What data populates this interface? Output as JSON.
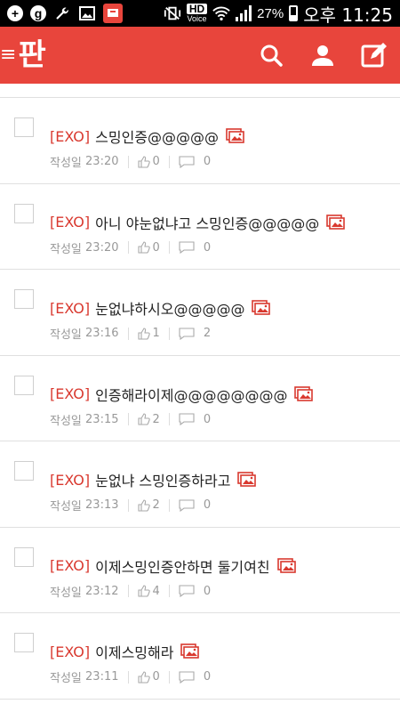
{
  "status_bar": {
    "battery": "27%",
    "time": "오후 11:25",
    "hd": "HD",
    "voice": "Voice"
  },
  "app": {
    "logo": "판",
    "menu_glyph": "≡"
  },
  "colors": {
    "accent": "#e8453c",
    "tag": "#d9392f"
  },
  "posts": [
    {
      "tag": "[EXO]",
      "title": "스밍인증@@@@@",
      "date_label": "작성일",
      "time": "23:20",
      "likes": "0",
      "comments": "0"
    },
    {
      "tag": "[EXO]",
      "title": "아니 야눈없냐고 스밍인증@@@@@",
      "date_label": "작성일",
      "time": "23:20",
      "likes": "0",
      "comments": "0"
    },
    {
      "tag": "[EXO]",
      "title": "눈없냐하시오@@@@@",
      "date_label": "작성일",
      "time": "23:16",
      "likes": "1",
      "comments": "2"
    },
    {
      "tag": "[EXO]",
      "title": "인증해라이제@@@@@@@@",
      "date_label": "작성일",
      "time": "23:15",
      "likes": "2",
      "comments": "0"
    },
    {
      "tag": "[EXO]",
      "title": "눈없냐 스밍인증하라고",
      "date_label": "작성일",
      "time": "23:13",
      "likes": "2",
      "comments": "0"
    },
    {
      "tag": "[EXO]",
      "title": "이제스밍인증안하면 둘기여친",
      "date_label": "작성일",
      "time": "23:12",
      "likes": "4",
      "comments": "0"
    },
    {
      "tag": "[EXO]",
      "title": "이제스밍해라",
      "date_label": "작성일",
      "time": "23:11",
      "likes": "0",
      "comments": "0"
    }
  ]
}
